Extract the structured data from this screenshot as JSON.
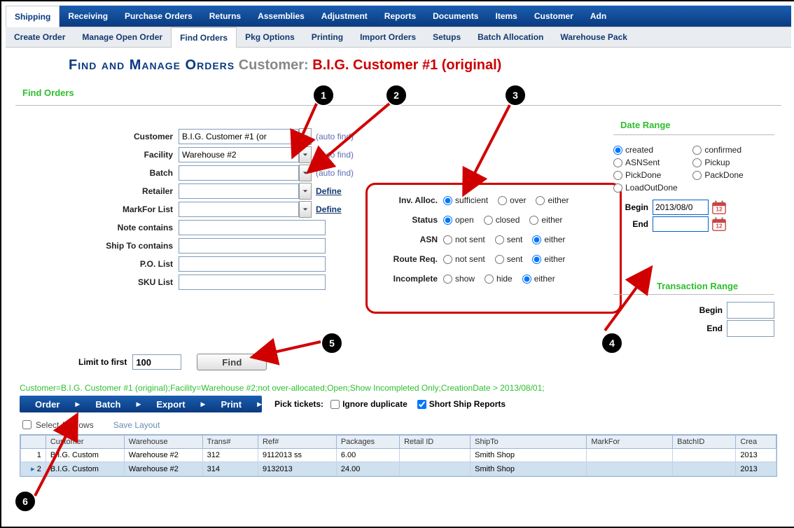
{
  "menubar": [
    "Shipping",
    "Receiving",
    "Purchase Orders",
    "Returns",
    "Assemblies",
    "Adjustment",
    "Reports",
    "Documents",
    "Items",
    "Customer",
    "Adn"
  ],
  "menubar_active": 0,
  "submenu": [
    "Create Order",
    "Manage Open Order",
    "Find Orders",
    "Pkg Options",
    "Printing",
    "Import Orders",
    "Setups",
    "Batch Allocation",
    "Warehouse Pack"
  ],
  "submenu_active": 2,
  "page_title": "Find and Manage Orders",
  "customer_label": "Customer:",
  "customer_name": "B.I.G. Customer #1 (original)",
  "find_orders_legend": "Find Orders",
  "fields": {
    "customer": {
      "label": "Customer",
      "value": "B.I.G. Customer #1 (or",
      "autofind": "(auto find)"
    },
    "facility": {
      "label": "Facility",
      "value": "Warehouse #2",
      "autofind": "(auto find)"
    },
    "batch": {
      "label": "Batch",
      "value": "",
      "autofind": "(auto find)"
    },
    "retailer": {
      "label": "Retailer",
      "value": "",
      "define": "Define"
    },
    "markfor": {
      "label": "MarkFor List",
      "value": "",
      "define": "Define"
    },
    "note": {
      "label": "Note contains",
      "value": ""
    },
    "shipto": {
      "label": "Ship To contains",
      "value": ""
    },
    "polist": {
      "label": "P.O. List",
      "value": ""
    },
    "skulist": {
      "label": "SKU List",
      "value": ""
    }
  },
  "radio_groups": [
    {
      "label": "Inv. Alloc.",
      "options": [
        "sufficient",
        "over",
        "either"
      ],
      "selected": 0
    },
    {
      "label": "Status",
      "options": [
        "open",
        "closed",
        "either"
      ],
      "selected": 0
    },
    {
      "label": "ASN",
      "options": [
        "not sent",
        "sent",
        "either"
      ],
      "selected": 2
    },
    {
      "label": "Route Req.",
      "options": [
        "not sent",
        "sent",
        "either"
      ],
      "selected": 2
    },
    {
      "label": "Incomplete",
      "options": [
        "show",
        "hide",
        "either"
      ],
      "selected": 2
    }
  ],
  "date_range": {
    "legend": "Date Range",
    "left": [
      "created",
      "ASNSent",
      "PickDone",
      "LoadOutDone"
    ],
    "right": [
      "confirmed",
      "Pickup",
      "PackDone"
    ],
    "selected": "created",
    "begin_label": "Begin",
    "begin_value": "2013/08/0",
    "end_label": "End",
    "end_value": ""
  },
  "transaction_range": {
    "legend": "Transaction Range",
    "begin_label": "Begin",
    "begin_value": "",
    "end_label": "End",
    "end_value": ""
  },
  "limit": {
    "label": "Limit to first",
    "value": "100",
    "button": "Find"
  },
  "filter_summary": "Customer=B.I.G. Customer #1 (original);Facility=Warehouse #2;not over-allocated;Open;Show Incompleted Only;CreationDate > 2013/08/01;",
  "action_menu": [
    "Order",
    "Batch",
    "Export",
    "Print"
  ],
  "pick": {
    "label": "Pick tickets:",
    "ignore": "Ignore duplicate",
    "short": "Short Ship Reports"
  },
  "grid_tools": {
    "select_all": "Select All Rows",
    "save": "Save Layout"
  },
  "grid": {
    "columns": [
      "",
      "Customer",
      "Warehouse",
      "Trans#",
      "Ref#",
      "Packages",
      "Retail ID",
      "ShipTo",
      "MarkFor",
      "BatchID",
      "Crea"
    ],
    "rows": [
      {
        "n": "1",
        "customer": "B.I.G. Custom",
        "warehouse": "Warehouse #2",
        "trans": "312",
        "ref": "9112013 ss",
        "packages": "6.00",
        "retail": "",
        "shipto": "Smith Shop",
        "markfor": "",
        "batch": "",
        "created": "2013"
      },
      {
        "n": "2",
        "customer": "B.I.G. Custom",
        "warehouse": "Warehouse #2",
        "trans": "314",
        "ref": "9132013",
        "packages": "24.00",
        "retail": "",
        "shipto": "Smith Shop",
        "markfor": "",
        "batch": "",
        "created": "2013"
      }
    ],
    "selected_row": 1
  },
  "annotations": [
    "1",
    "2",
    "3",
    "4",
    "5",
    "6"
  ]
}
